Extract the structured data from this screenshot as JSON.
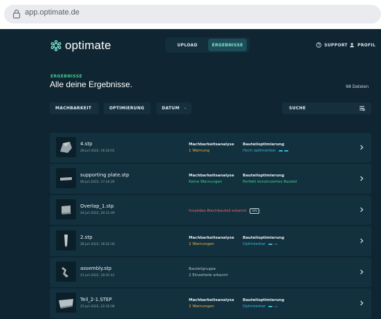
{
  "browser": {
    "url": "app.optimate.de"
  },
  "brand": {
    "name": "optimate"
  },
  "nav": {
    "upload": "UPLOAD",
    "results": "ERGEBNISSE"
  },
  "topbar": {
    "support": "SUPPORT",
    "profile": "PROFIL"
  },
  "page": {
    "kicker": "ERGEBNISSE",
    "title": "Alle deine Ergebnisse.",
    "count": "98 Dateien"
  },
  "filters": {
    "feasibility": "MACHBARKEIT",
    "optimization": "OPTIMIERUNG",
    "date": "DATUM",
    "search": "SUCHE"
  },
  "rows": [
    {
      "name": "4.stp",
      "date": "28 Juli 2022, 16:24:01",
      "col1_label": "Machbarkeitsanalyse",
      "col1_value": "1 Warnung",
      "col2_label": "Bauteiloptimierung",
      "col2_value": "Hoch optimierbar",
      "level": 2
    },
    {
      "name": "supporting plate.stp",
      "date": "06 Juli 2022, 17:14:26",
      "col1_label": "Machbarkeitsanalyse",
      "col1_value": "Keine Warnungen",
      "col2_label": "Bauteiloptimierung",
      "col2_value": "Perfekt konstruiertes Bauteil"
    },
    {
      "name": "Overlap_1.stp",
      "date": "24 Juli 2022, 20:11:49",
      "info": "Invalides Blechbauteil erkannt",
      "badge": "Info"
    },
    {
      "name": "2.stp",
      "date": "28 Juli 2022, 16:22:30",
      "col1_label": "Machbarkeitsanalyse",
      "col1_value": "2 Warnungen",
      "col2_label": "Bauteiloptimierung",
      "col2_value": "Optimierbar",
      "level": 1
    },
    {
      "name": "assembly.stp",
      "date": "21 Juli 2022, 10:01:12",
      "group_label": "Bauteilgruppe",
      "group_value": "2 Einzelteile erkannt"
    },
    {
      "name": "Teil_2-1.STEP",
      "date": "25 Juli 2022, 22:32:08",
      "col1_label": "Machbarkeitsanalyse",
      "col1_value": "2 Warnungen",
      "col2_label": "Bauteiloptimierung",
      "col2_value": "Optimierbar",
      "level": 1
    }
  ],
  "colors": {
    "background": "#0f2632",
    "accent": "#7fe6cf",
    "warning": "#f1b143",
    "success": "#41d58b",
    "info": "#3bb7d8",
    "error": "#f06a5c"
  },
  "icons": {
    "lock": "lock-icon",
    "support": "help-circle-icon",
    "profile": "user-icon",
    "search": "filter-lines-icon",
    "chevron": "chevron-right-icon",
    "dropdown": "chevron-down-icon"
  }
}
